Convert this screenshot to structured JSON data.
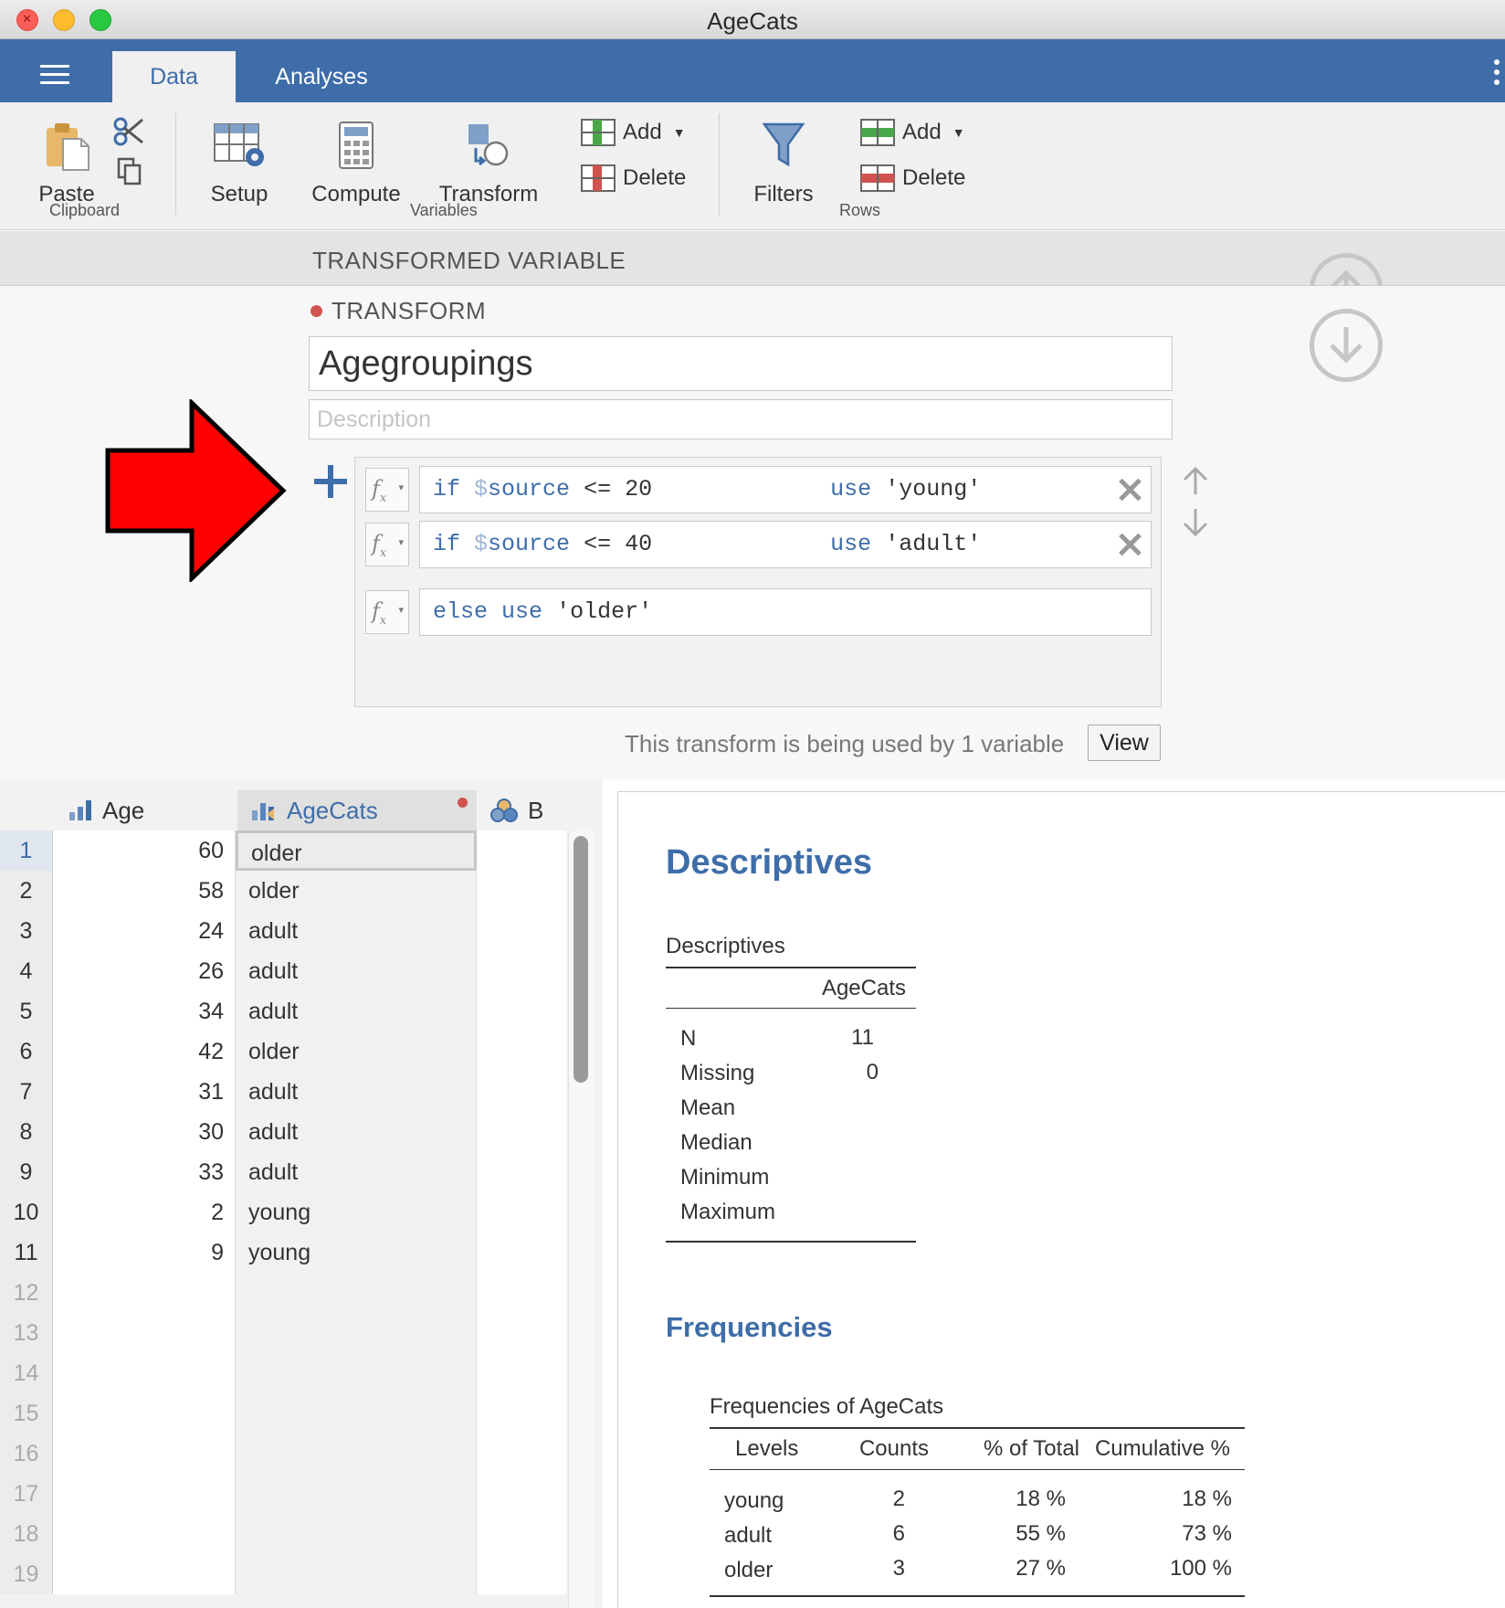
{
  "window": {
    "title": "AgeCats"
  },
  "tabs": [
    {
      "label": "Data"
    },
    {
      "label": "Analyses"
    }
  ],
  "ribbon": {
    "clipboard": {
      "paste": "Paste",
      "group": "Clipboard"
    },
    "variables": {
      "setup": "Setup",
      "compute": "Compute",
      "transform": "Transform",
      "add": "Add",
      "delete": "Delete",
      "group": "Variables"
    },
    "rows": {
      "filters": "Filters",
      "add": "Add",
      "delete": "Delete",
      "group": "Rows"
    }
  },
  "editor": {
    "header": "TRANSFORMED VARIABLE",
    "section": "TRANSFORM",
    "name": "Agegroupings",
    "description_placeholder": "Description",
    "conditions": [
      {
        "if": "if",
        "var": "$",
        "source": "source",
        "op": "<=",
        "value": "20",
        "use": "use",
        "result": "'young'"
      },
      {
        "if": "if",
        "var": "$",
        "source": "source",
        "op": "<=",
        "value": "40",
        "use": "use",
        "result": "'adult'"
      }
    ],
    "else": {
      "else": "else",
      "use": "use",
      "result": "'older'"
    },
    "usage_text": "This transform is being used by 1 variable",
    "view_button": "View"
  },
  "spreadsheet": {
    "columns": [
      "Age",
      "AgeCats",
      "B"
    ],
    "rows": [
      {
        "n": "1",
        "age": "60",
        "cat": "older"
      },
      {
        "n": "2",
        "age": "58",
        "cat": "older"
      },
      {
        "n": "3",
        "age": "24",
        "cat": "adult"
      },
      {
        "n": "4",
        "age": "26",
        "cat": "adult"
      },
      {
        "n": "5",
        "age": "34",
        "cat": "adult"
      },
      {
        "n": "6",
        "age": "42",
        "cat": "older"
      },
      {
        "n": "7",
        "age": "31",
        "cat": "adult"
      },
      {
        "n": "8",
        "age": "30",
        "cat": "adult"
      },
      {
        "n": "9",
        "age": "33",
        "cat": "adult"
      },
      {
        "n": "10",
        "age": "2",
        "cat": "young"
      },
      {
        "n": "11",
        "age": "9",
        "cat": "young"
      }
    ],
    "empty_rows": [
      "12",
      "13",
      "14",
      "15",
      "16",
      "17",
      "18",
      "19"
    ]
  },
  "results": {
    "descriptives": {
      "heading": "Descriptives",
      "table_title": "Descriptives",
      "column": "AgeCats",
      "rows": [
        {
          "label": "N",
          "value": "11"
        },
        {
          "label": "Missing",
          "value": "0"
        },
        {
          "label": "Mean",
          "value": ""
        },
        {
          "label": "Median",
          "value": ""
        },
        {
          "label": "Minimum",
          "value": ""
        },
        {
          "label": "Maximum",
          "value": ""
        }
      ]
    },
    "frequencies": {
      "heading": "Frequencies",
      "table_title": "Frequencies of AgeCats",
      "columns": [
        "Levels",
        "Counts",
        "% of Total",
        "Cumulative %"
      ],
      "rows": [
        {
          "level": "young",
          "count": "2",
          "pct": "18 %",
          "cum": "18 %"
        },
        {
          "level": "adult",
          "count": "6",
          "pct": "55 %",
          "cum": "73 %"
        },
        {
          "level": "older",
          "count": "3",
          "pct": "27 %",
          "cum": "100 %"
        }
      ]
    }
  },
  "colors": {
    "accent": "#3e6da9",
    "status_dot": "#d0534f",
    "arrow": "#ff0000"
  }
}
